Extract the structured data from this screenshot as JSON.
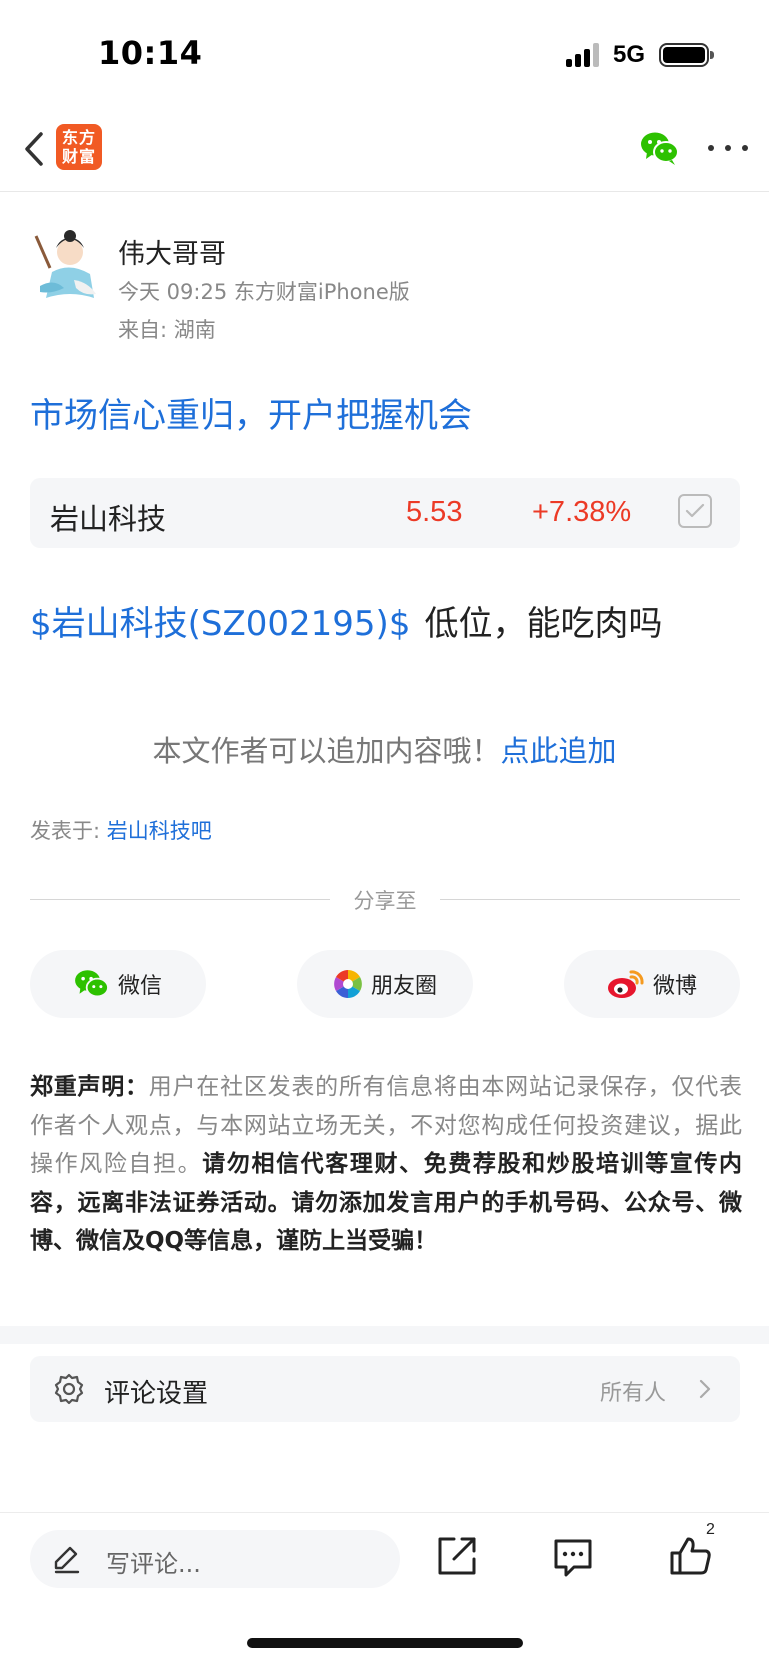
{
  "status_bar": {
    "time": "10:14",
    "network": "5G"
  },
  "nav": {
    "logo_line1": "东方",
    "logo_line2": "财富"
  },
  "author": {
    "name": "伟大哥哥",
    "meta": "今天 09:25 东方财富iPhone版",
    "from": "来自: 湖南"
  },
  "post": {
    "title": "市场信心重归，开户把握机会",
    "stock": {
      "name": "岩山科技",
      "price": "5.53",
      "change": "+7.38%"
    },
    "body_stock_link": "$岩山科技(SZ002195)$",
    "body_text": "低位，能吃肉吗",
    "append_hint": "本文作者可以追加内容哦！",
    "append_link": "点此追加",
    "posted_in_label": "发表于: ",
    "posted_in_bar": "岩山科技吧"
  },
  "share": {
    "label": "分享至",
    "buttons": [
      {
        "label": "微信",
        "icon": "wechat-icon"
      },
      {
        "label": "朋友圈",
        "icon": "moments-icon"
      },
      {
        "label": "微博",
        "icon": "weibo-icon"
      }
    ]
  },
  "disclaimer": {
    "title": "郑重声明：",
    "normal": "用户在社区发表的所有信息将由本网站记录保存，仅代表作者个人观点，与本网站立场无关，不对您构成任何投资建议，据此操作风险自担。",
    "bold": "请勿相信代客理财、免费荐股和炒股培训等宣传内容，远离非法证券活动。请勿添加发言用户的手机号码、公众号、微博、微信及QQ等信息，谨防上当受骗！"
  },
  "comment_settings": {
    "label": "评论设置",
    "value": "所有人"
  },
  "bottom_bar": {
    "comment_placeholder": "写评论...",
    "like_count": "2"
  },
  "colors": {
    "brand": "#f15a24",
    "link": "#1e6fd9",
    "up": "#ec3a26",
    "wechat": "#2dc100"
  }
}
